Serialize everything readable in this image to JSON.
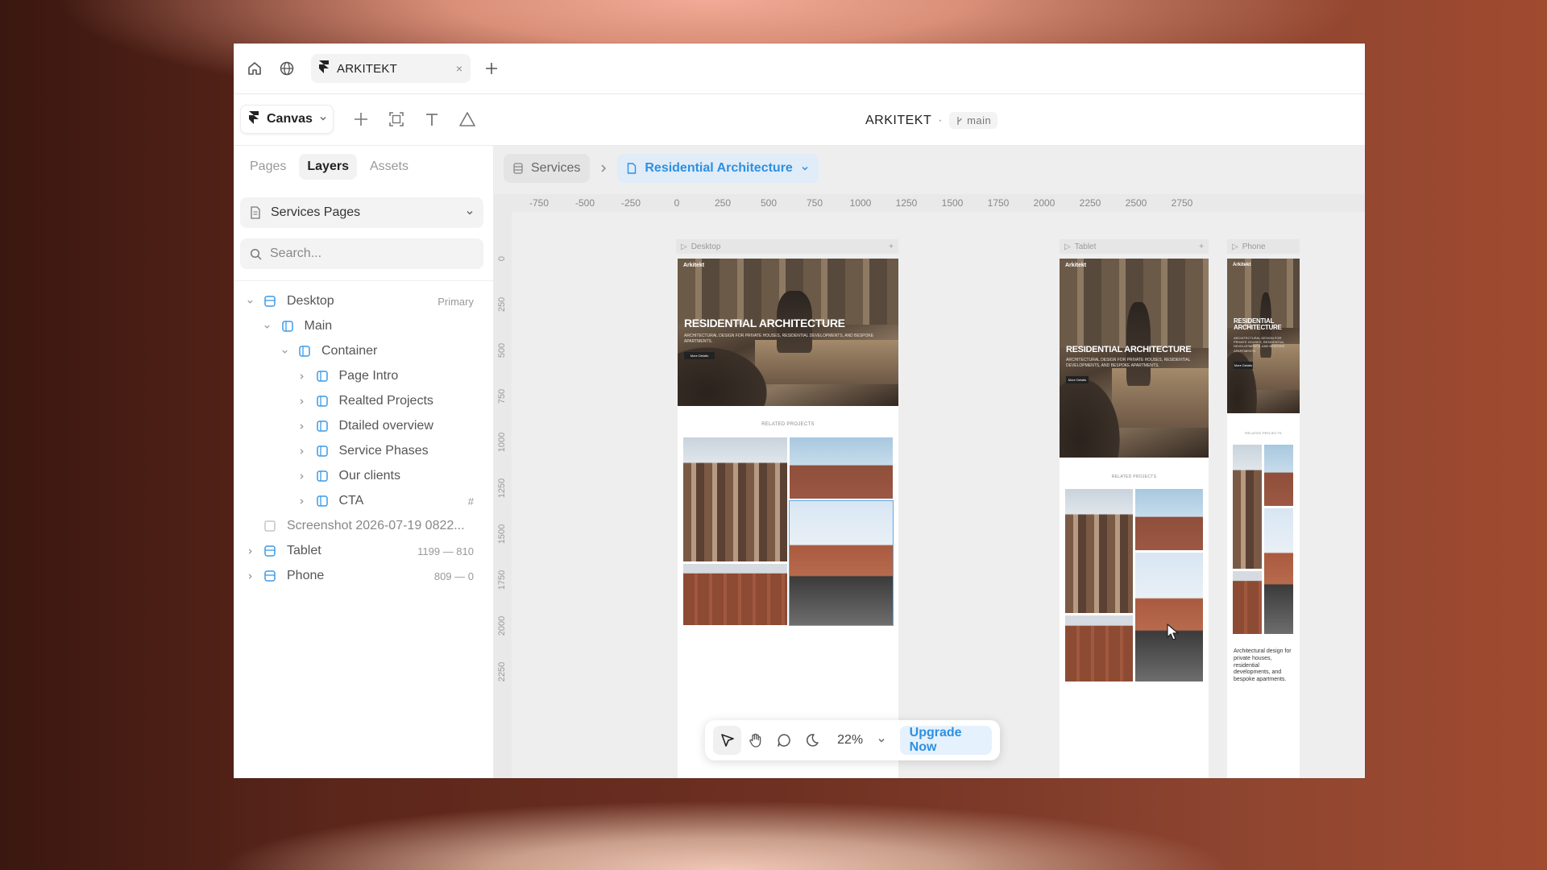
{
  "tabbar": {
    "tab_title": "ARKITEKT",
    "close_glyph": "×",
    "new_tab_glyph": "+"
  },
  "toolbar": {
    "canvas_label": "Canvas",
    "project_name": "ARKITEKT",
    "separator": "·",
    "branch": "main"
  },
  "sidebar": {
    "tabs": [
      {
        "label": "Pages",
        "active": false
      },
      {
        "label": "Layers",
        "active": true
      },
      {
        "label": "Assets",
        "active": false
      }
    ],
    "page_selector": "Services Pages",
    "search_placeholder": "Search...",
    "layers": [
      {
        "label": "Desktop",
        "meta": "Primary",
        "level": 0,
        "expanded": true
      },
      {
        "label": "Main",
        "meta": "",
        "level": 1,
        "expanded": true
      },
      {
        "label": "Container",
        "meta": "",
        "level": 2,
        "expanded": true
      },
      {
        "label": "Page Intro",
        "meta": "",
        "level": 3,
        "expanded": false
      },
      {
        "label": "Realted Projects",
        "meta": "",
        "level": 3,
        "expanded": false
      },
      {
        "label": "Dtailed overview",
        "meta": "",
        "level": 3,
        "expanded": false
      },
      {
        "label": "Service Phases",
        "meta": "",
        "level": 3,
        "expanded": false
      },
      {
        "label": "Our clients",
        "meta": "",
        "level": 3,
        "expanded": false
      },
      {
        "label": "CTA",
        "meta": "#",
        "level": 3,
        "expanded": false
      },
      {
        "label": "Screenshot 2026-07-19 0822...",
        "meta": "",
        "level": 0,
        "expanded": false
      },
      {
        "label": "Tablet",
        "meta": "1199 — 810",
        "level": 0,
        "expanded": false
      },
      {
        "label": "Phone",
        "meta": "809 — 0",
        "level": 0,
        "expanded": false
      }
    ]
  },
  "canvas": {
    "breadcrumb_parent": "Services",
    "breadcrumb_current": "Residential Architecture",
    "ruler_h": [
      "-750",
      "-500",
      "-250",
      "0",
      "250",
      "500",
      "750",
      "1000",
      "1250",
      "1500",
      "1750",
      "2000",
      "2250",
      "2500",
      "2750"
    ],
    "ruler_v": [
      "0",
      "250",
      "500",
      "750",
      "1000",
      "1250",
      "1500",
      "1750",
      "2000",
      "2250"
    ],
    "frames": {
      "desktop_label": "Desktop",
      "tablet_label": "Tablet",
      "phone_label": "Phone",
      "brand": "Arkitekt",
      "hero_title": "RESIDENTIAL ARCHITECTURE",
      "hero_sub": "ARCHITECTURAL DESIGN FOR PRIVATE HOUSES, RESIDENTIAL DEVELOPMENTS, AND BESPOKE APARTMENTS.",
      "hero_btn": "More Details",
      "related": "RELATED PROJECTS",
      "phone_text": "Architectural design for private houses, residential developments, and bespoke apartments."
    },
    "bottom_bar": {
      "zoom": "22%",
      "upgrade": "Upgrade Now"
    }
  },
  "colors": {
    "accent": "#2e90e0",
    "accent_bg": "#e5f1fc",
    "layer_icon": "#3b9ae8"
  }
}
